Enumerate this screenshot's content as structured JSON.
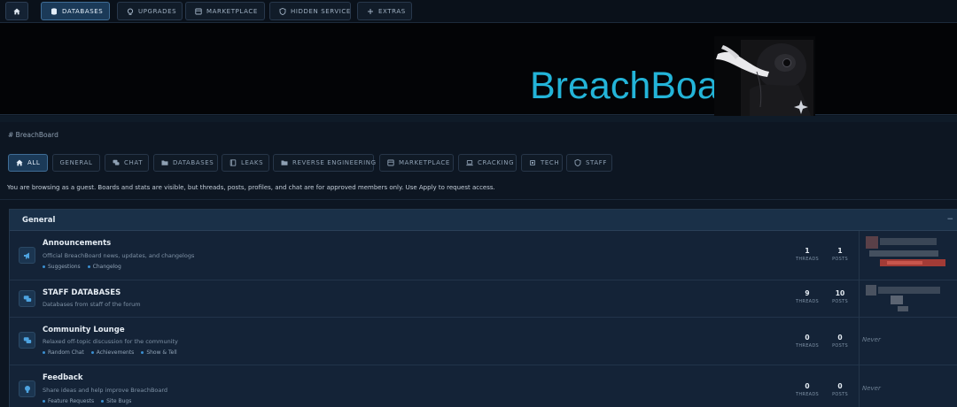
{
  "topnav": {
    "home_icon": "home-icon",
    "items": [
      {
        "label": "DATABASES",
        "icon": "database-icon",
        "active": true
      },
      {
        "label": "UPGRADES",
        "icon": "upgrade-icon",
        "active": false
      },
      {
        "label": "MARKETPLACE",
        "icon": "store-icon",
        "active": false
      },
      {
        "label": "HIDDEN SERVICE",
        "icon": "shield-icon",
        "active": false
      },
      {
        "label": "EXTRAS",
        "icon": "plus-icon",
        "active": false
      }
    ]
  },
  "banner": {
    "logo_text": "BreachBoard"
  },
  "breadcrumb": {
    "text": "# BreachBoard"
  },
  "categories": [
    {
      "label": "ALL",
      "icon": "home-icon",
      "active": true
    },
    {
      "label": "GENERAL",
      "icon": "",
      "active": false
    },
    {
      "label": "CHAT",
      "icon": "chat-icon",
      "active": false
    },
    {
      "label": "DATABASES",
      "icon": "folder-icon",
      "active": false
    },
    {
      "label": "LEAKS",
      "icon": "book-icon",
      "active": false
    },
    {
      "label": "REVERSE ENGINEERING",
      "icon": "folder-icon",
      "active": false
    },
    {
      "label": "MARKETPLACE",
      "icon": "store-icon",
      "active": false
    },
    {
      "label": "CRACKING",
      "icon": "laptop-icon",
      "active": false
    },
    {
      "label": "TECH",
      "icon": "chip-icon",
      "active": false
    },
    {
      "label": "STAFF",
      "icon": "shield-icon",
      "active": false
    }
  ],
  "guest_notice": "You are browsing as a guest. Boards and stats are visible, but threads, posts, profiles, and chat are for approved members only. Use Apply to request access.",
  "section": {
    "title": "General",
    "collapse": "−"
  },
  "forums": [
    {
      "name": "Announcements",
      "icon": "megaphone-icon",
      "description": "Official BreachBoard news, updates, and changelogs",
      "subforums": [
        "Suggestions",
        "Changelog"
      ],
      "threads": "1",
      "posts": "1",
      "threads_label": "THREADS",
      "posts_label": "POSTS",
      "last_post": "redacted"
    },
    {
      "name": "STAFF DATABASES",
      "icon": "chat-bubbles-icon",
      "description": "Databases from staff of the forum",
      "subforums": [],
      "threads": "9",
      "posts": "10",
      "threads_label": "THREADS",
      "posts_label": "POSTS",
      "last_post": "redacted"
    },
    {
      "name": "Community Lounge",
      "icon": "chat-bubbles-icon",
      "description": "Relaxed off-topic discussion for the community",
      "subforums": [
        "Random Chat",
        "Achievements",
        "Show & Tell"
      ],
      "threads": "0",
      "posts": "0",
      "threads_label": "THREADS",
      "posts_label": "POSTS",
      "last_post": "Never"
    },
    {
      "name": "Feedback",
      "icon": "lightbulb-icon",
      "description": "Share ideas and help improve BreachBoard",
      "subforums": [
        "Feature Requests",
        "Site Bugs"
      ],
      "threads": "0",
      "posts": "0",
      "threads_label": "THREADS",
      "posts_label": "POSTS",
      "last_post": "Never"
    }
  ],
  "colors": {
    "accent": "#23b4d8",
    "background": "#0d1622",
    "active_button": "#1b3a58"
  }
}
